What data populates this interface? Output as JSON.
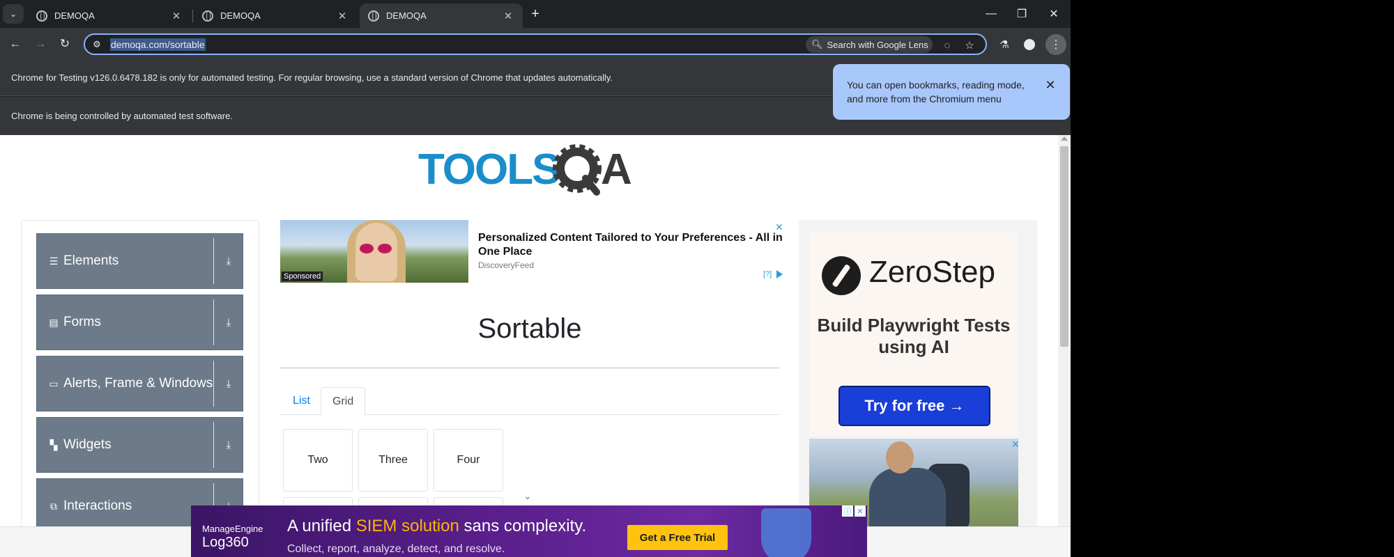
{
  "browser": {
    "tabs": [
      {
        "title": "DEMOQA",
        "close": "✕",
        "active": false
      },
      {
        "title": "DEMOQA",
        "close": "✕",
        "active": false
      },
      {
        "title": "DEMOQA",
        "close": "✕",
        "active": true
      }
    ],
    "new_tab": "+",
    "url": "demoqa.com/sortable",
    "lens_label": "Search with Google Lens",
    "infobar_testing": "Chrome for Testing v126.0.6478.182 is only for automated testing. For regular browsing, use a standard version of Chrome that updates automatically.",
    "infobar_automation": "Chrome is being controlled by automated test software.",
    "menu_tip": "You can open bookmarks, reading mode, and more from the Chromium menu",
    "icons": {
      "tab_search": "chevron-down-icon",
      "back": "back-arrow-icon",
      "forward": "forward-arrow-icon",
      "reload": "reload-icon",
      "site_info": "tune-icon",
      "lens": "search-icon",
      "eye_off": "eye-off-icon",
      "bookmark": "star-icon",
      "labs": "flask-icon",
      "profile": "person-icon",
      "menu": "kebab-menu-icon"
    },
    "accent_color": "#8ab4f8"
  },
  "sidebar": {
    "groups": [
      {
        "title": "Elements",
        "icon": "list-icon"
      },
      {
        "title": "Forms",
        "icon": "document-icon"
      },
      {
        "title": "Alerts, Frame & Windows",
        "icon": "window-icon"
      },
      {
        "title": "Widgets",
        "icon": "widgets-icon"
      },
      {
        "title": "Interactions",
        "icon": "interactions-icon"
      }
    ],
    "group_color": "#6c7a89"
  },
  "ad_top": {
    "title": "Personalized Content Tailored to Your Preferences - All in One Place",
    "source": "DiscoveryFeed",
    "sponsored": "Sponsored",
    "help": "[?]",
    "close": "✕"
  },
  "main": {
    "heading": "Sortable",
    "tabs": [
      {
        "label": "List",
        "active": false
      },
      {
        "label": "Grid",
        "active": true
      }
    ],
    "grid_items": [
      "Two",
      "Three",
      "Four"
    ]
  },
  "ad_right": {
    "brand": "ZeroStep",
    "tagline": "Build Playwright Tests using AI",
    "cta": "Try for free →",
    "close": "✕"
  },
  "ad_bottom": {
    "brand_top": "ManageEngine",
    "brand_bottom": "Log360",
    "headline_pre": "A unified ",
    "headline_highlight": "SIEM solution",
    "headline_post": " sans complexity.",
    "subline": "Collect, report, analyze, detect, and resolve.",
    "cta": "Get a Free Trial",
    "highlight_color": "#ffb400"
  }
}
